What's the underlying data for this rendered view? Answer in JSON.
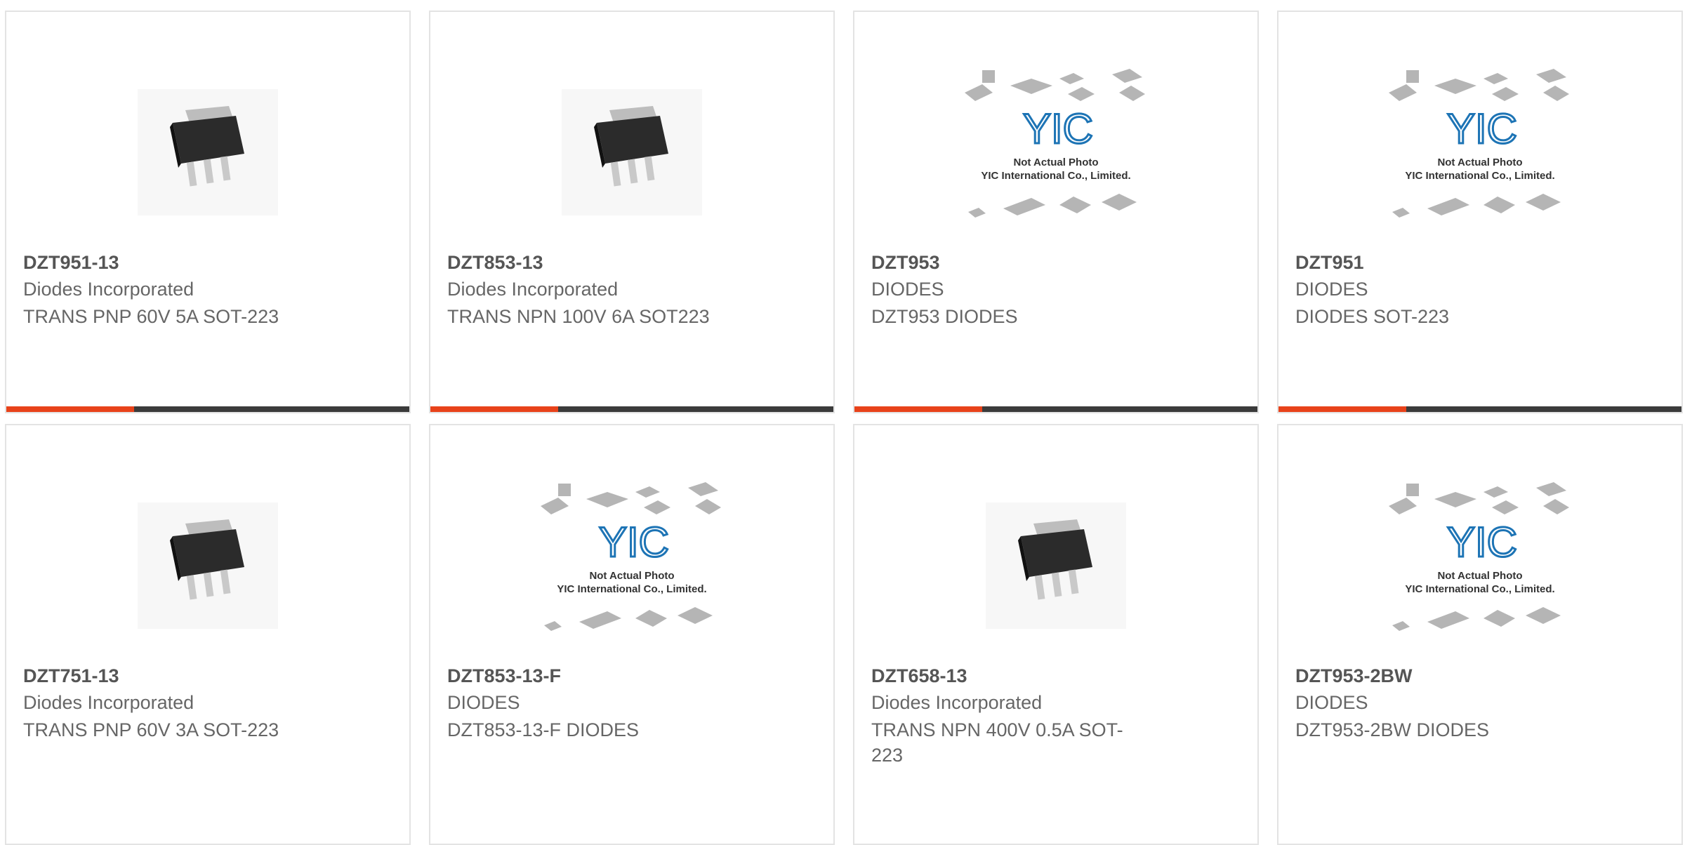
{
  "accent_color": "#e8421a",
  "placeholder_image": {
    "line1": "Not Actual Photo",
    "line2": "YIC International Co., Limited."
  },
  "products": [
    {
      "part": "DZT951-13",
      "manufacturer": "Diodes Incorporated",
      "description": "TRANS PNP 60V 5A SOT-223",
      "image": "sot223-chip-icon"
    },
    {
      "part": "DZT853-13",
      "manufacturer": "Diodes Incorporated",
      "description": "TRANS NPN 100V 6A SOT223",
      "image": "sot223-chip-icon"
    },
    {
      "part": "DZT953",
      "manufacturer": "DIODES",
      "description": "DZT953 DIODES",
      "image": "yic-placeholder-icon"
    },
    {
      "part": "DZT951",
      "manufacturer": "DIODES",
      "description": "DIODES SOT-223",
      "image": "yic-placeholder-icon"
    },
    {
      "part": "DZT751-13",
      "manufacturer": "Diodes Incorporated",
      "description": "TRANS PNP 60V 3A SOT-223",
      "image": "sot223-chip-icon"
    },
    {
      "part": "DZT853-13-F",
      "manufacturer": "DIODES",
      "description": "DZT853-13-F DIODES",
      "image": "yic-placeholder-icon"
    },
    {
      "part": "DZT658-13",
      "manufacturer": "Diodes Incorporated",
      "description": "TRANS NPN 400V 0.5A SOT-223",
      "image": "sot223-chip-icon"
    },
    {
      "part": "DZT953-2BW",
      "manufacturer": "DIODES",
      "description": "DZT953-2BW DIODES",
      "image": "yic-placeholder-icon"
    }
  ]
}
